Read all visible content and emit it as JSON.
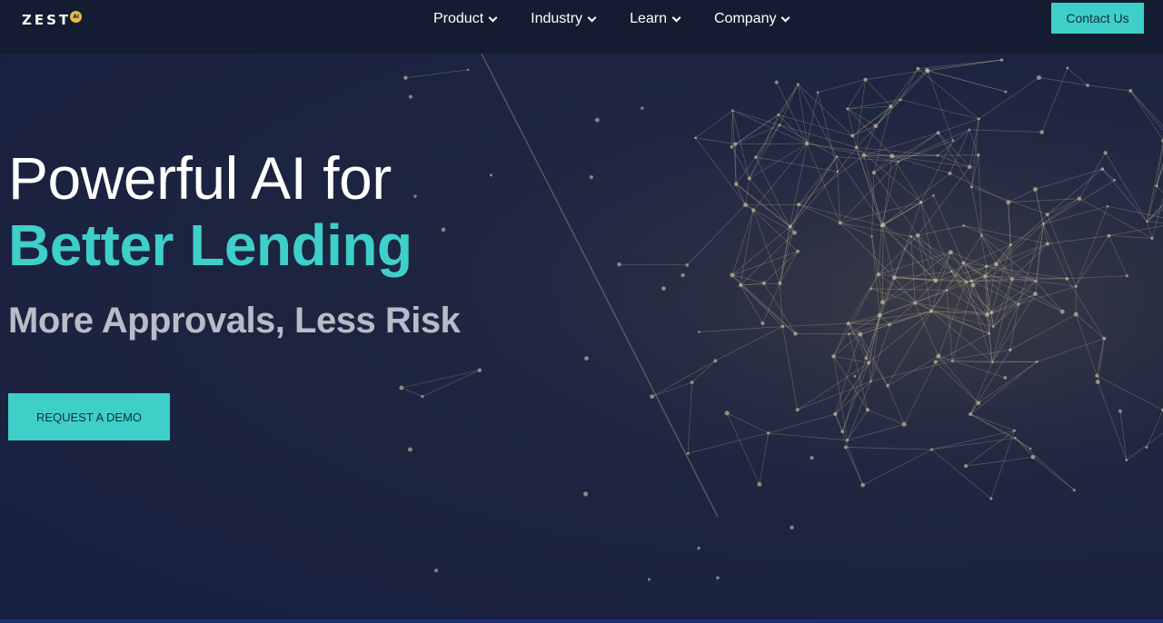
{
  "header": {
    "logo_text": "ZEST",
    "logo_badge": "AI",
    "nav": [
      {
        "label": "Product"
      },
      {
        "label": "Industry"
      },
      {
        "label": "Learn"
      },
      {
        "label": "Company"
      }
    ],
    "contact_label": "Contact Us"
  },
  "hero": {
    "title_line1": "Powerful AI for",
    "title_line2": "Better Lending",
    "subtitle": "More Approvals, Less Risk",
    "cta_label": "REQUEST A DEMO"
  },
  "colors": {
    "accent": "#3ecfc9",
    "header_bg": "#131c30",
    "page_bg": "#18223f",
    "subtitle": "#b9bcc7",
    "logo_badge": "#e9b949"
  },
  "icons": {
    "nav_dropdown": "chevron-down-icon",
    "background": "network-graph"
  }
}
